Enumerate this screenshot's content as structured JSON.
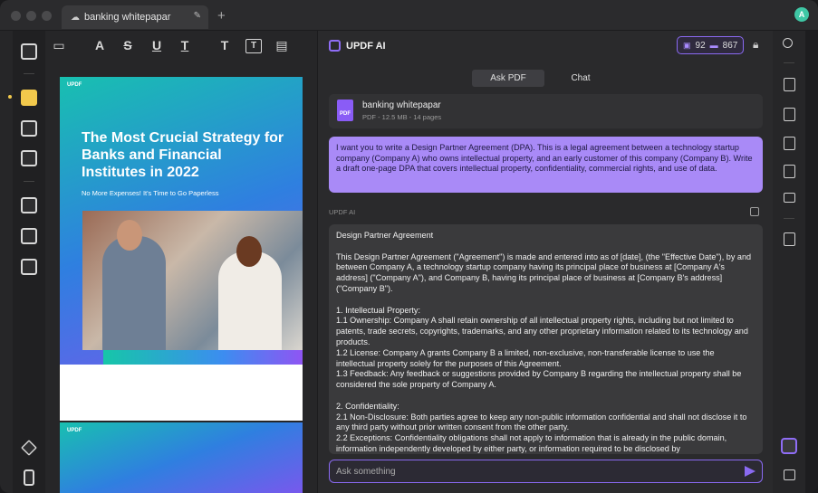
{
  "tab": {
    "title": "banking whitepapar"
  },
  "pdf": {
    "logo": "UPDF",
    "title": "The Most Crucial Strategy for Banks and Financial Institutes in 2022",
    "subtitle": "No More Expenses! It's Time to Go Paperless",
    "page2_logo": "UPDF"
  },
  "ai": {
    "title": "UPDF AI",
    "credits_a": "92",
    "credits_b": "867",
    "tabs": [
      "Ask PDF",
      "Chat"
    ],
    "file": {
      "name": "banking whitepapar",
      "meta": "PDF - 12.5 MB - 14 pages",
      "badge": "PDF"
    },
    "prompt": "I want you to write a Design Partner Agreement (DPA). This is a legal agreement between a technology startup company (Company A) who owns intellectual property, and an early customer of this company (Company B). Write a draft one-page DPA that covers intellectual property, confidentiality, commercial rights, and use of data.",
    "responder": "UPDF AI",
    "answer": {
      "heading": "Design Partner Agreement",
      "intro": "This Design Partner Agreement (\"Agreement\") is made and entered into as of [date], (the \"Effective Date\"), by and between Company A, a technology startup company having its principal place of business at [Company A's address] (\"Company A\"), and Company B, having its principal place of business at [Company B's address] (\"Company B\").",
      "s1": "1. Intellectual Property:",
      "s1_1": "1.1 Ownership: Company A shall retain ownership of all intellectual property rights, including but not limited to patents, trade secrets, copyrights, trademarks, and any other proprietary information related to its technology and products.",
      "s1_2": "1.2 License: Company A grants Company B a limited, non-exclusive, non-transferable license to use the intellectual property solely for the purposes of this Agreement.",
      "s1_3": "1.3 Feedback: Any feedback or suggestions provided by Company B regarding the intellectual property shall be considered the sole property of Company A.",
      "s2": "2. Confidentiality:",
      "s2_1": "2.1 Non-Disclosure: Both parties agree to keep any non-public information confidential and shall not disclose it to any third party without prior written consent from the other party.",
      "s2_2": "2.2 Exceptions: Confidentiality obligations shall not apply to information that is already in the public domain, information independently developed by either party, or information required to be disclosed by"
    },
    "input_placeholder": "Ask something"
  },
  "colors": {
    "accent": "#8a6af2",
    "prompt_bg": "#a98af7",
    "highlight": "#f2c94c"
  }
}
